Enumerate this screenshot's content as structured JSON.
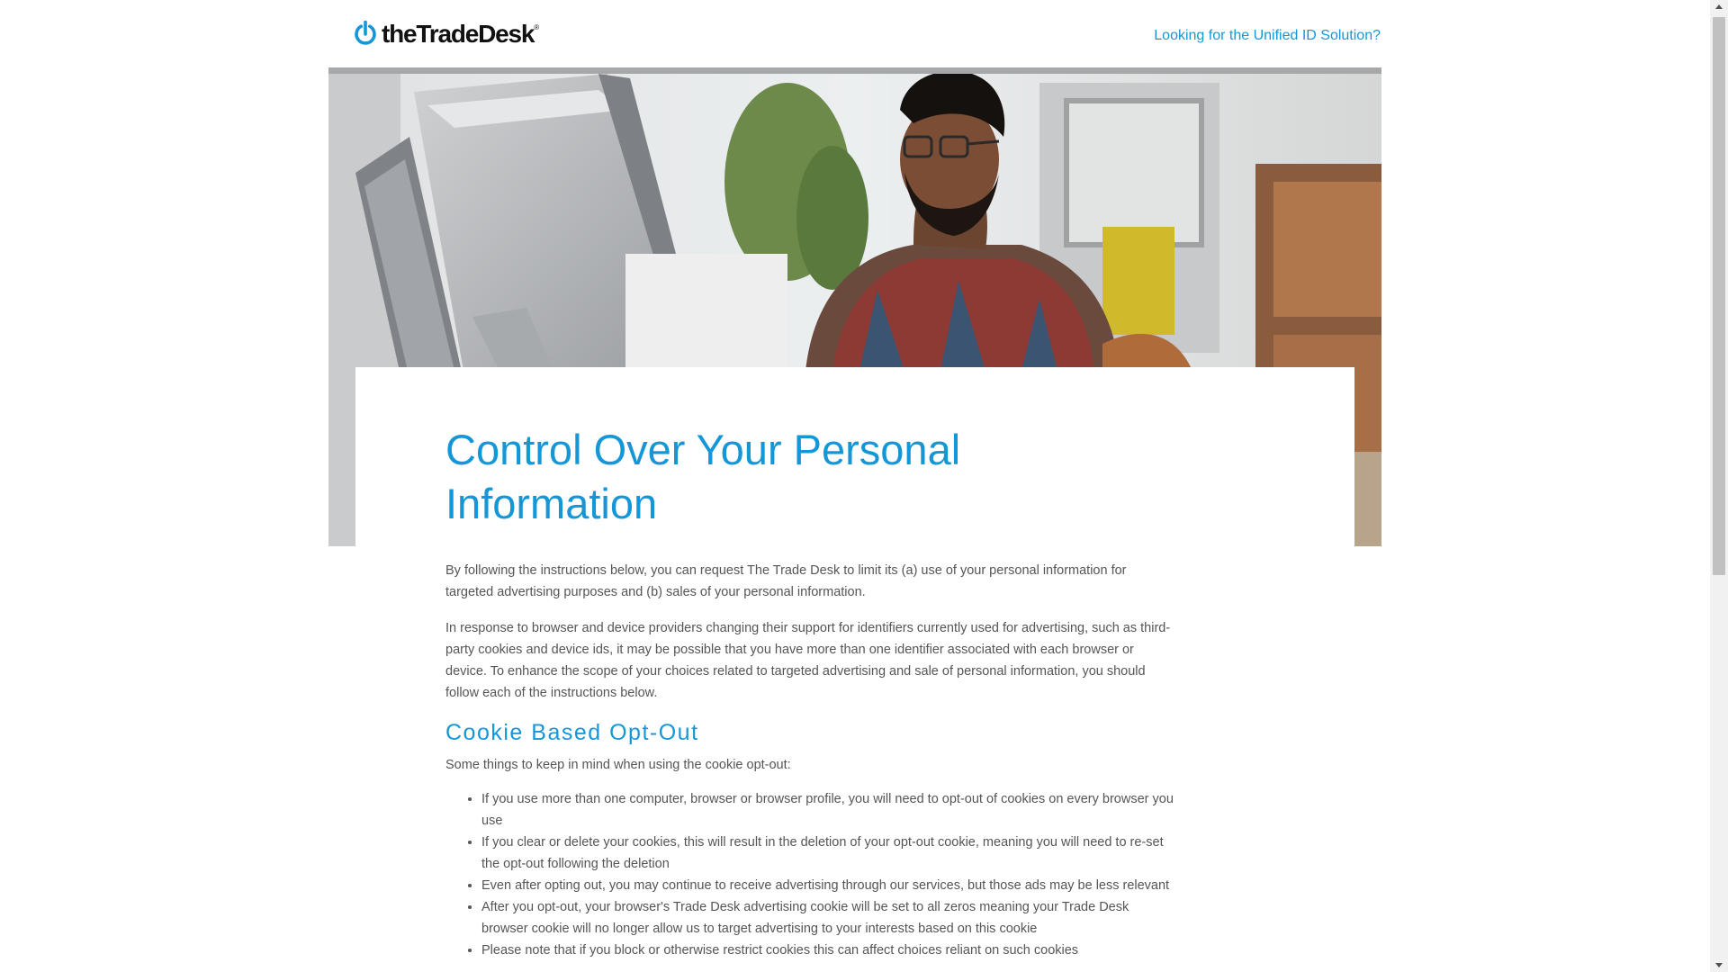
{
  "header": {
    "logo_text": "theTradeDesk",
    "logo_tm": "®",
    "unified_id_link": "Looking for the Unified ID Solution?"
  },
  "main": {
    "title": "Control Over Your Personal Information",
    "intro_p1": "By following the instructions below, you can request The Trade Desk to limit its (a) use of your personal information for targeted advertising purposes and (b) sales of your personal information.",
    "intro_p2": "In response to browser and device providers changing their support for identifiers currently used for advertising, such as third-party cookies and device ids, it may be possible that you have more than one identifier associated with each browser or device. To enhance the scope of your choices related to targeted advertising and sale of personal information, you should follow each of the instructions below.",
    "cookie_heading": "Cookie Based Opt-Out",
    "cookie_intro": "Some things to keep in mind when using the cookie opt-out:",
    "cookie_bullets": [
      "If you use more than one computer, browser or browser profile, you will need to opt-out of cookies on every browser you use",
      "If you clear or delete your cookies, this will result in the deletion of your opt-out cookie, meaning you will need to re-set the opt-out following the deletion",
      "Even after opting out, you may continue to receive advertising through our services, but those ads may be less relevant",
      "After you opt-out, your browser's Trade Desk advertising cookie will be set to all zeros meaning your Trade Desk browser cookie will no longer allow us to target advertising to your interests based on this cookie",
      "Please note that if you block or otherwise restrict cookies this can affect choices reliant on such cookies"
    ]
  },
  "colors": {
    "accent": "#1597d7",
    "body_text": "#555555",
    "logo_text": "#111111"
  },
  "icons": {
    "logo": "power-icon",
    "scroll_up": "triangle-up-icon",
    "scroll_down": "triangle-down-icon"
  }
}
